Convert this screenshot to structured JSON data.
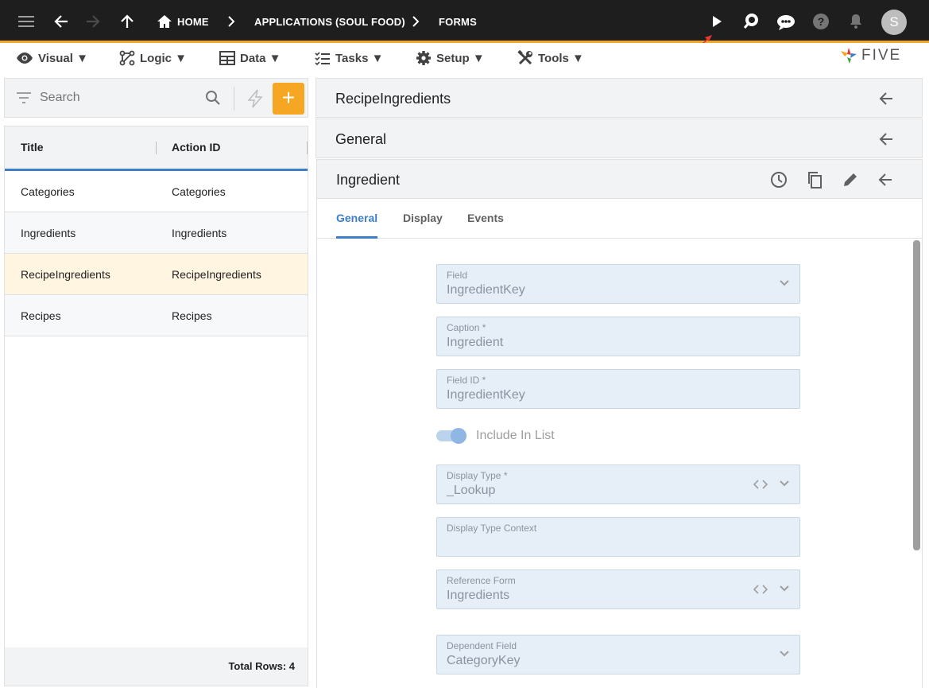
{
  "topbar": {
    "breadcrumbs": [
      "HOME",
      "APPLICATIONS (SOUL FOOD)",
      "FORMS"
    ],
    "avatar_initial": "S",
    "icons": [
      "menu-icon",
      "back-arrow-icon",
      "forward-arrow-icon",
      "up-arrow-icon",
      "home-icon",
      "play-icon",
      "search-chat-icon",
      "chat-bot-icon",
      "help-icon",
      "bell-icon"
    ]
  },
  "menubar": {
    "items": [
      {
        "label": "Visual ▼",
        "icon": "eye-icon"
      },
      {
        "label": "Logic ▼",
        "icon": "logic-icon"
      },
      {
        "label": "Data ▼",
        "icon": "table-icon"
      },
      {
        "label": "Tasks ▼",
        "icon": "tasks-icon"
      },
      {
        "label": "Setup ▼",
        "icon": "gear-icon"
      },
      {
        "label": "Tools ▼",
        "icon": "tools-icon"
      }
    ],
    "logo_text": "FIVE"
  },
  "sidebar": {
    "search_placeholder": "Search",
    "columns": [
      "Title",
      "Action ID"
    ],
    "rows": [
      {
        "title": "Categories",
        "action_id": "Categories"
      },
      {
        "title": "Ingredients",
        "action_id": "Ingredients"
      },
      {
        "title": "RecipeIngredients",
        "action_id": "RecipeIngredients"
      },
      {
        "title": "Recipes",
        "action_id": "Recipes"
      }
    ],
    "selected_row": 2,
    "total_rows": "Total Rows: 4"
  },
  "main": {
    "panel1_title": "RecipeIngredients",
    "panel2_title": "General",
    "panel3_title": "Ingredient",
    "tabs": [
      "General",
      "Display",
      "Events"
    ],
    "active_tab": "General",
    "fields": {
      "field": {
        "label": "Field",
        "value": "IngredientKey"
      },
      "caption": {
        "label": "Caption *",
        "value": "Ingredient"
      },
      "field_id": {
        "label": "Field ID *",
        "value": "IngredientKey"
      },
      "include_in_list": {
        "label": "Include In List",
        "checked": true
      },
      "display_type": {
        "label": "Display Type *",
        "value": "_Lookup"
      },
      "display_type_context": {
        "label": "Display Type Context",
        "value": ""
      },
      "reference_form": {
        "label": "Reference Form",
        "value": "Ingredients"
      },
      "dependent_field": {
        "label": "Dependent Field",
        "value": "CategoryKey"
      }
    }
  },
  "colors": {
    "topbar_bg": "#1e1e1e",
    "accent_orange": "#f5a623",
    "accent_blue": "#3d7ecb",
    "selected_row_bg": "#fff5e0"
  }
}
